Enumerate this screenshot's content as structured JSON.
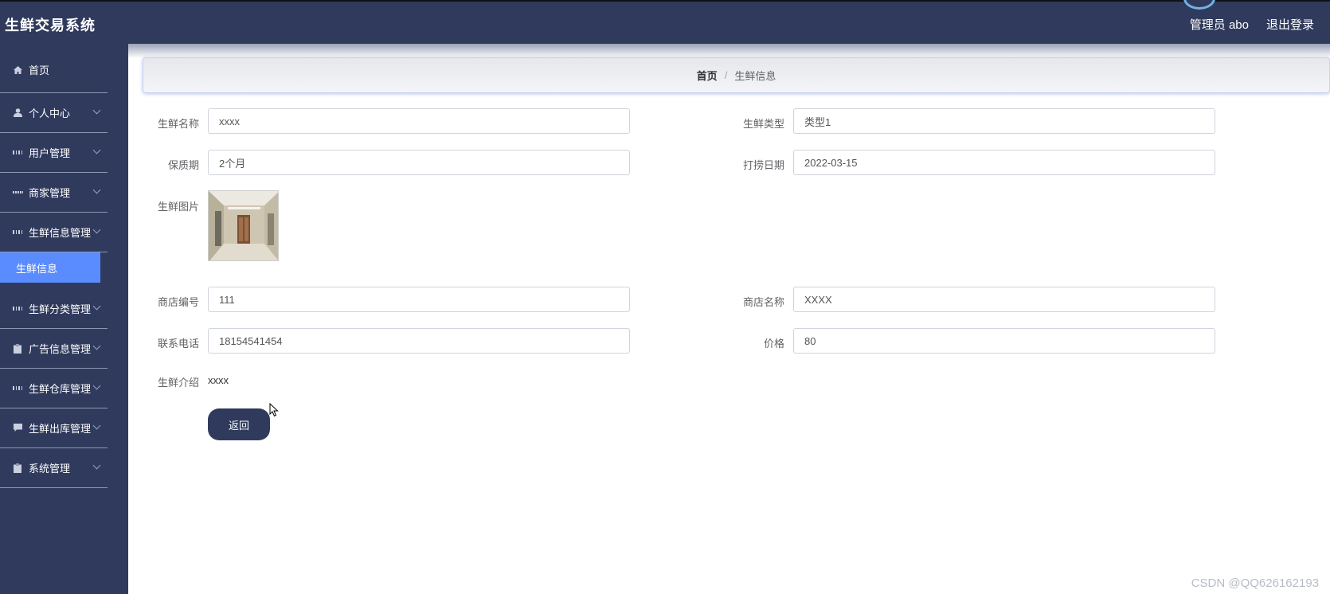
{
  "app": {
    "title": "生鲜交易系统"
  },
  "header": {
    "user_label": "管理员 abo",
    "logout_label": "退出登录"
  },
  "sidebar": {
    "items": [
      {
        "label": "首页",
        "icon": "home-icon"
      },
      {
        "label": "个人中心",
        "icon": "person-icon"
      },
      {
        "label": "用户管理",
        "icon": "grid-icon"
      },
      {
        "label": "商家管理",
        "icon": "dots-grid-icon"
      },
      {
        "label": "生鲜信息管理",
        "icon": "grid-icon"
      },
      {
        "label": "生鲜分类管理",
        "icon": "grid-icon"
      },
      {
        "label": "广告信息管理",
        "icon": "clipboard-icon"
      },
      {
        "label": "生鲜仓库管理",
        "icon": "grid-icon"
      },
      {
        "label": "生鲜出库管理",
        "icon": "chat-icon"
      },
      {
        "label": "系统管理",
        "icon": "clipboard-icon"
      }
    ],
    "active_sub": "生鲜信息"
  },
  "breadcrumb": {
    "home": "首页",
    "separator": "/",
    "current": "生鲜信息"
  },
  "form": {
    "name": {
      "label": "生鲜名称",
      "value": "xxxx"
    },
    "type": {
      "label": "生鲜类型",
      "value": "类型1"
    },
    "shelf_life": {
      "label": "保质期",
      "value": "2个月"
    },
    "catch_date": {
      "label": "打捞日期",
      "value": "2022-03-15"
    },
    "image": {
      "label": "生鲜图片"
    },
    "shop_no": {
      "label": "商店编号",
      "value": "111"
    },
    "shop_name": {
      "label": "商店名称",
      "value": "XXXX"
    },
    "phone": {
      "label": "联系电话",
      "value": "18154541454"
    },
    "price": {
      "label": "价格",
      "value": "80"
    },
    "intro": {
      "label": "生鲜介绍",
      "value": "xxxx"
    },
    "back_label": "返回"
  },
  "watermark": "CSDN @QQ626162193",
  "colors": {
    "nav_bg": "#2f3a5c",
    "active": "#5b8cff"
  }
}
